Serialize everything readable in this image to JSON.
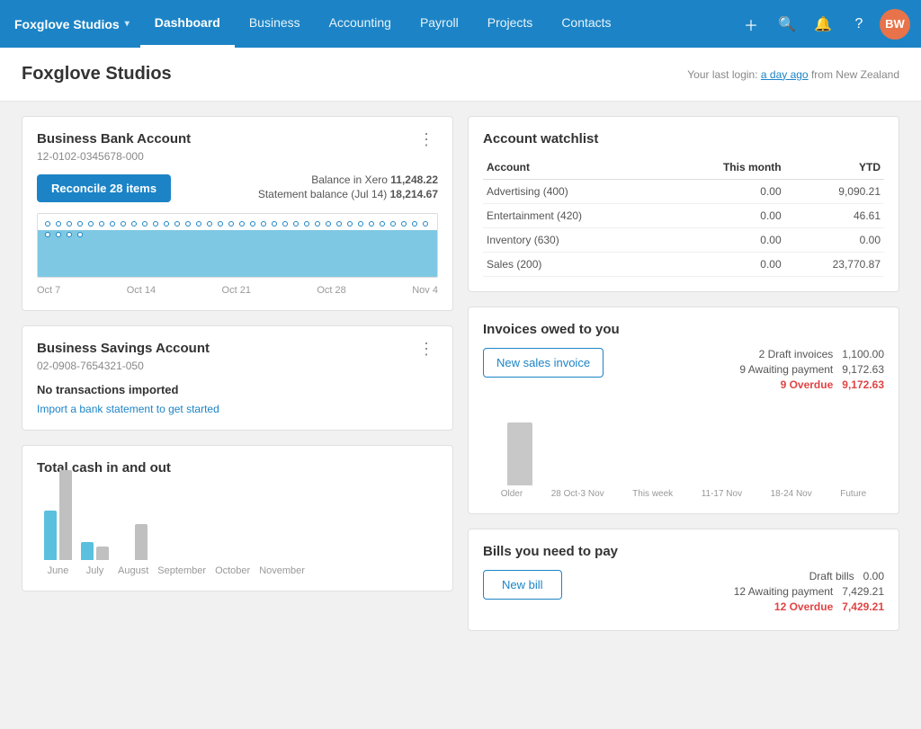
{
  "nav": {
    "brand": "Foxglove Studios",
    "items": [
      {
        "label": "Dashboard",
        "active": true
      },
      {
        "label": "Business",
        "active": false
      },
      {
        "label": "Accounting",
        "active": false
      },
      {
        "label": "Payroll",
        "active": false
      },
      {
        "label": "Projects",
        "active": false
      },
      {
        "label": "Contacts",
        "active": false
      }
    ],
    "avatar": "BW"
  },
  "page": {
    "title": "Foxglove Studios",
    "last_login": "Your last login:",
    "last_login_time": "a day ago",
    "last_login_location": "from New Zealand"
  },
  "bank_account": {
    "title": "Business Bank Account",
    "account_number": "12-0102-0345678-000",
    "reconcile_label": "Reconcile 28 items",
    "balance_label": "Balance in Xero",
    "balance_value": "11,248.22",
    "statement_label": "Statement balance (Jul 14)",
    "statement_value": "18,214.67",
    "chart_labels": [
      "Oct 7",
      "Oct 14",
      "Oct 21",
      "Oct 28",
      "Nov 4"
    ]
  },
  "savings_account": {
    "title": "Business Savings Account",
    "account_number": "02-0908-7654321-050",
    "no_transactions": "No transactions imported",
    "import_link": "Import a bank statement to get started"
  },
  "total_cash": {
    "title": "Total cash in and out",
    "months": [
      "June",
      "July",
      "August",
      "September",
      "October",
      "November"
    ],
    "bars_in": [
      55,
      20,
      0,
      0,
      0,
      0
    ],
    "bars_out": [
      100,
      15,
      40,
      0,
      0,
      0
    ]
  },
  "watchlist": {
    "title": "Account watchlist",
    "headers": [
      "Account",
      "This month",
      "YTD"
    ],
    "rows": [
      {
        "account": "Advertising (400)",
        "this_month": "0.00",
        "ytd": "9,090.21"
      },
      {
        "account": "Entertainment (420)",
        "this_month": "0.00",
        "ytd": "46.61"
      },
      {
        "account": "Inventory (630)",
        "this_month": "0.00",
        "ytd": "0.00"
      },
      {
        "account": "Sales (200)",
        "this_month": "0.00",
        "ytd": "23,770.87"
      }
    ]
  },
  "invoices": {
    "title": "Invoices owed to you",
    "new_invoice_label": "New sales invoice",
    "draft_label": "2 Draft invoices",
    "draft_value": "1,100.00",
    "awaiting_label": "9 Awaiting payment",
    "awaiting_value": "9,172.63",
    "overdue_label": "9 Overdue",
    "overdue_value": "9,172.63",
    "chart_labels": [
      "Older",
      "28 Oct-3 Nov",
      "This week",
      "11-17 Nov",
      "18-24 Nov",
      "Future"
    ],
    "chart_heights": [
      70,
      0,
      0,
      0,
      0,
      0
    ]
  },
  "bills": {
    "title": "Bills you need to pay",
    "new_bill_label": "New bill",
    "draft_label": "Draft bills",
    "draft_value": "0.00",
    "awaiting_label": "12 Awaiting payment",
    "awaiting_value": "7,429.21",
    "overdue_label": "12 Overdue",
    "overdue_value": "7,429.21"
  }
}
